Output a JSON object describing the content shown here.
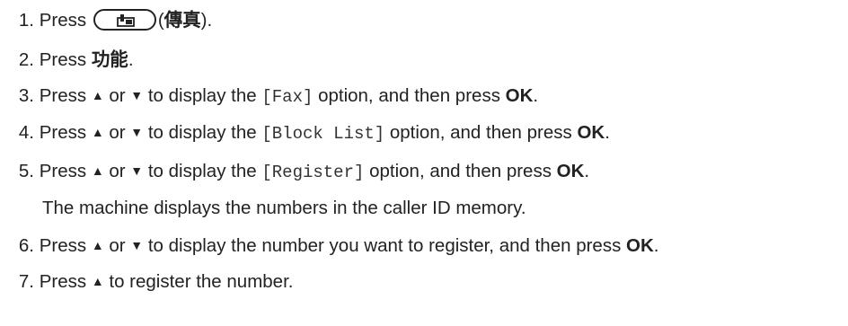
{
  "steps": [
    {
      "num": "1.",
      "pre": "Press ",
      "label": "傳真",
      "post": ")."
    },
    {
      "num": "2.",
      "pre": "Press ",
      "key": "功能",
      "post": "."
    },
    {
      "num": "3.",
      "pre": "Press ",
      "up": "▲",
      "or": " or ",
      "down": "▼",
      "mid": " to display the ",
      "option": "[Fax]",
      "then": " option, and then press ",
      "ok": "OK",
      "end": "."
    },
    {
      "num": "4.",
      "pre": "Press ",
      "up": "▲",
      "or": " or ",
      "down": "▼",
      "mid": " to display the ",
      "option": "[Block List]",
      "then": " option, and then press ",
      "ok": "OK",
      "end": "."
    },
    {
      "num": "5.",
      "pre": "Press ",
      "up": "▲",
      "or": " or ",
      "down": "▼",
      "mid": " to display the ",
      "option": "[Register]",
      "then": " option, and then press ",
      "ok": "OK",
      "end": "."
    },
    {
      "num": "6.",
      "pre": "Press ",
      "up": "▲",
      "or": " or ",
      "down": "▼",
      "mid": " to display the number you want to register, and then press ",
      "ok": "OK",
      "end": "."
    },
    {
      "num": "7.",
      "pre": "Press ",
      "up": "▲",
      "rest": " to register the number."
    }
  ],
  "step5_note": "The machine displays the numbers in the caller ID memory."
}
